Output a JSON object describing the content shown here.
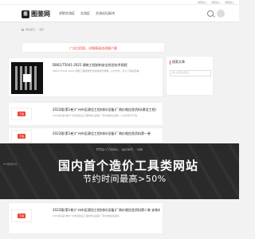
{
  "topbar": {
    "links": [
      "求职加入",
      "求职加入",
      "求职加入"
    ]
  },
  "header": {
    "logo_mark": "图",
    "logo_text": "图鉴网",
    "nav": [
      "求职交流区",
      "交流区",
      "交流论坛板块"
    ]
  },
  "breadcrumb": {
    "home": "网站首页",
    "sep": "›",
    "current": "首页"
  },
  "ad_banner": "广告位招租，详细情请咨询客户客",
  "sidebar": {
    "title": "搜索文章",
    "search_placeholder": "输入搜索关键词"
  },
  "cards": [
    {
      "title": "DB61/T5041-2022 建筑工程结构安全检验技术规程",
      "desc": "DB61/T5041-2022 建筑工程结构安全检验技术规程，pdf文件。可以下载后查看。"
    },
    {
      "badge": "下载",
      "title": "2022版(第1卷)广州市区建设工程材料(设备)厂商价格信息资料(建设工程)",
      "desc": "2022版(第1卷)广州市区建设工程材料(设备)厂商价格信息资料...pdf文件可下载"
    },
    {
      "badge": "下载",
      "title": "2022版(第1卷)广州市区建设工程材料(设备)厂商价格信息资料第一卷",
      "desc": "2022版(第1卷)广州市区建设工程材料(设备)厂商价格信息资料...pdf文件可下载"
    },
    {
      "badge": "下载",
      "title": "2022版(第1卷)广州市区建设工程材料(设备)厂商价格信息资料第二卷 安装材料(5)",
      "desc": "2022版(第1卷)广州市区建设工程材料(设备)厂商价格信息资料..."
    }
  ],
  "promo": {
    "url": "http://zaiu. xycost. com",
    "tag": "BIM数据整合",
    "main": "国内首个造价工具类网站",
    "sub": "节约时间最高>50%"
  }
}
